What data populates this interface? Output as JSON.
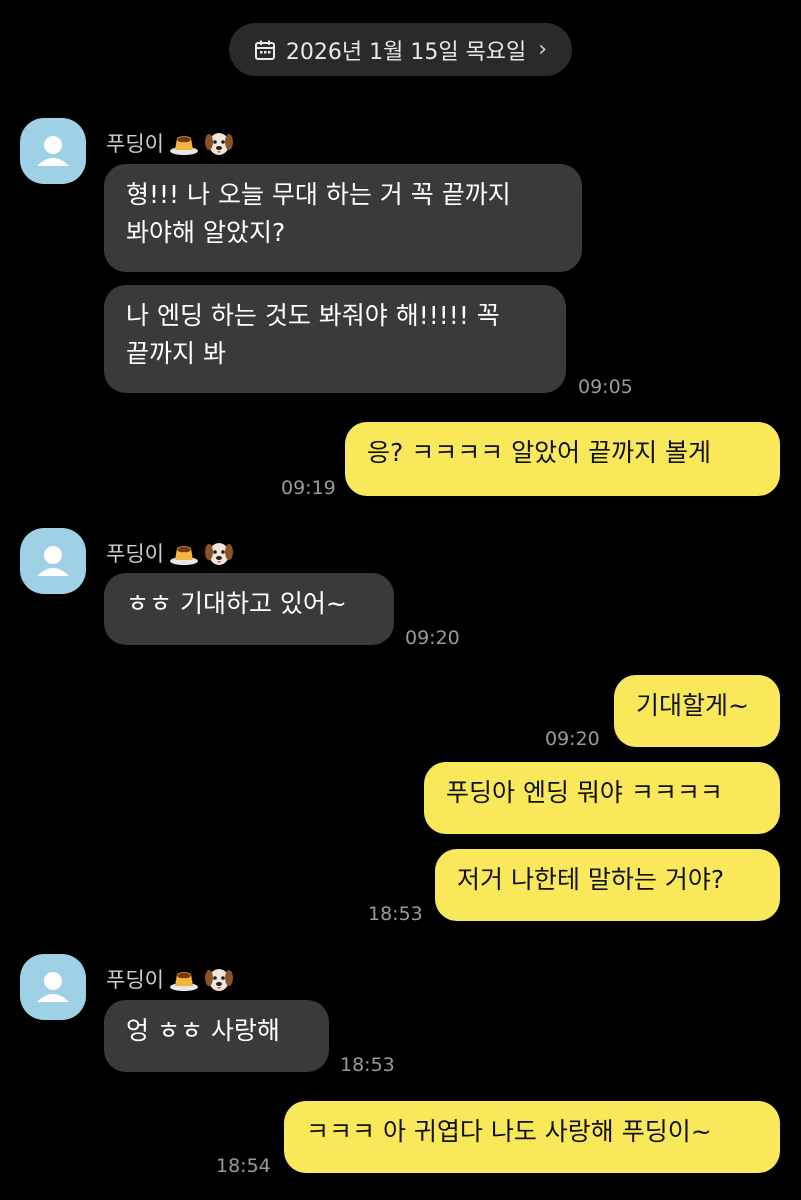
{
  "date_header": {
    "label": "2026년 1월 15일 목요일",
    "icon": "calendar-icon",
    "chevron": "›"
  },
  "contact": {
    "name": "푸딩이",
    "emoji": [
      "pudding-emoji",
      "dog-emoji"
    ]
  },
  "messages": [
    {
      "from": "them",
      "text": "형!!! 나 오늘 무대 하는 거 꼭 끝까지\n봐야해 알았지?"
    },
    {
      "from": "them",
      "text": "나 엔딩 하는 것도 봐줘야 해!!!!! 꼭\n끝까지 봐",
      "time": "09:05"
    },
    {
      "from": "me",
      "text": "응? ㅋㅋㅋㅋ 알았어 끝까지 볼게",
      "time": "09:19"
    },
    {
      "from": "them",
      "text": "ㅎㅎ 기대하고 있어~",
      "time": "09:20"
    },
    {
      "from": "me",
      "text": "기대할게~",
      "time": "09:20"
    },
    {
      "from": "me",
      "text": "푸딩아 엔딩 뭐야 ㅋㅋㅋㅋ"
    },
    {
      "from": "me",
      "text": "저거 나한테 말하는 거야?",
      "time": "18:53"
    },
    {
      "from": "them",
      "text": "엉 ㅎㅎ 사랑해",
      "time": "18:53"
    },
    {
      "from": "me",
      "text": "ㅋㅋㅋ 아 귀엽다 나도 사랑해 푸딩이~",
      "time": "18:54"
    }
  ],
  "colors": {
    "background": "#000000",
    "incoming_bubble": "#3a3a3c",
    "outgoing_bubble": "#f9e85a",
    "avatar": "#9ed1e6"
  }
}
